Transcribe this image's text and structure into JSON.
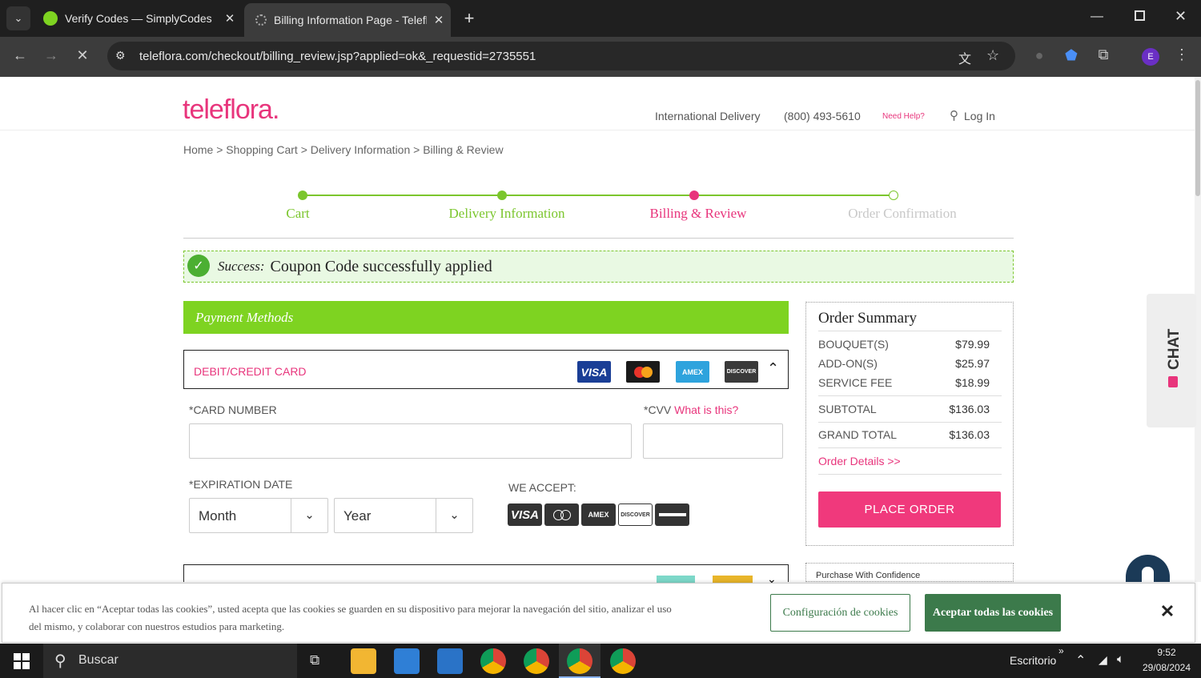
{
  "browser": {
    "tabs": [
      {
        "label": "Verify Codes — SimplyCodes"
      },
      {
        "label": "Billing Information Page - Telefl"
      }
    ],
    "url": "teleflora.com/checkout/billing_review.jsp?applied=ok&_requestid=2735551",
    "profile_initial": "E"
  },
  "header": {
    "logo": "teleflora.",
    "intl": "International Delivery",
    "phone": "(800) 493-5610",
    "help": "Need Help?",
    "login": "Log In"
  },
  "breadcrumb": "Home > Shopping Cart > Delivery Information > Billing & Review",
  "steps": [
    {
      "label": "Cart",
      "color": "#7bc62d"
    },
    {
      "label": "Delivery Information",
      "color": "#7bc62d"
    },
    {
      "label": "Billing & Review",
      "color": "#e8357c"
    },
    {
      "label": "Order Confirmation",
      "color": "#c8c8c8"
    }
  ],
  "alert": {
    "prefix": "Success:",
    "message": "Coupon Code successfully applied"
  },
  "payment": {
    "title": "Payment Methods",
    "method": "DEBIT/CREDIT CARD",
    "card_logos": [
      "VISA",
      "MasterCard",
      "AMEX",
      "DISCOVER"
    ],
    "card_number_label": "*CARD NUMBER",
    "cvv_label": "*CVV",
    "cvv_help": "What is this?",
    "exp_label": "*EXPIRATION DATE",
    "month": "Month",
    "year": "Year",
    "accept_label": "WE ACCEPT:",
    "accept_logos": [
      "VISA",
      "MasterCard",
      "AMEX",
      "DISCOVER",
      ""
    ]
  },
  "summary": {
    "title": "Order Summary",
    "rows": [
      {
        "label": "BOUQUET(S)",
        "value": "$79.99"
      },
      {
        "label": "ADD-ON(S)",
        "value": "$25.97"
      },
      {
        "label": "SERVICE FEE",
        "value": "$18.99"
      },
      {
        "label": "SUBTOTAL",
        "value": "$136.03"
      },
      {
        "label": "GRAND TOTAL",
        "value": "$136.03"
      }
    ],
    "details_link": "Order Details >>",
    "place_order": "PLACE ORDER",
    "confidence": "Purchase With Confidence"
  },
  "chat": {
    "label": "CHAT"
  },
  "cookie": {
    "text": "Al hacer clic en “Aceptar todas las cookies”, usted acepta que las cookies se guarden en su dispositivo para mejorar la navegación del sitio, analizar el uso del mismo, y colaborar con nuestros estudios para marketing.",
    "settings": "Configuración de cookies",
    "accept": "Aceptar todas las cookies",
    "close": "✕"
  },
  "taskbar": {
    "search": "Buscar",
    "desktop": "Escritorio",
    "time": "9:52",
    "date": "29/08/2024"
  }
}
